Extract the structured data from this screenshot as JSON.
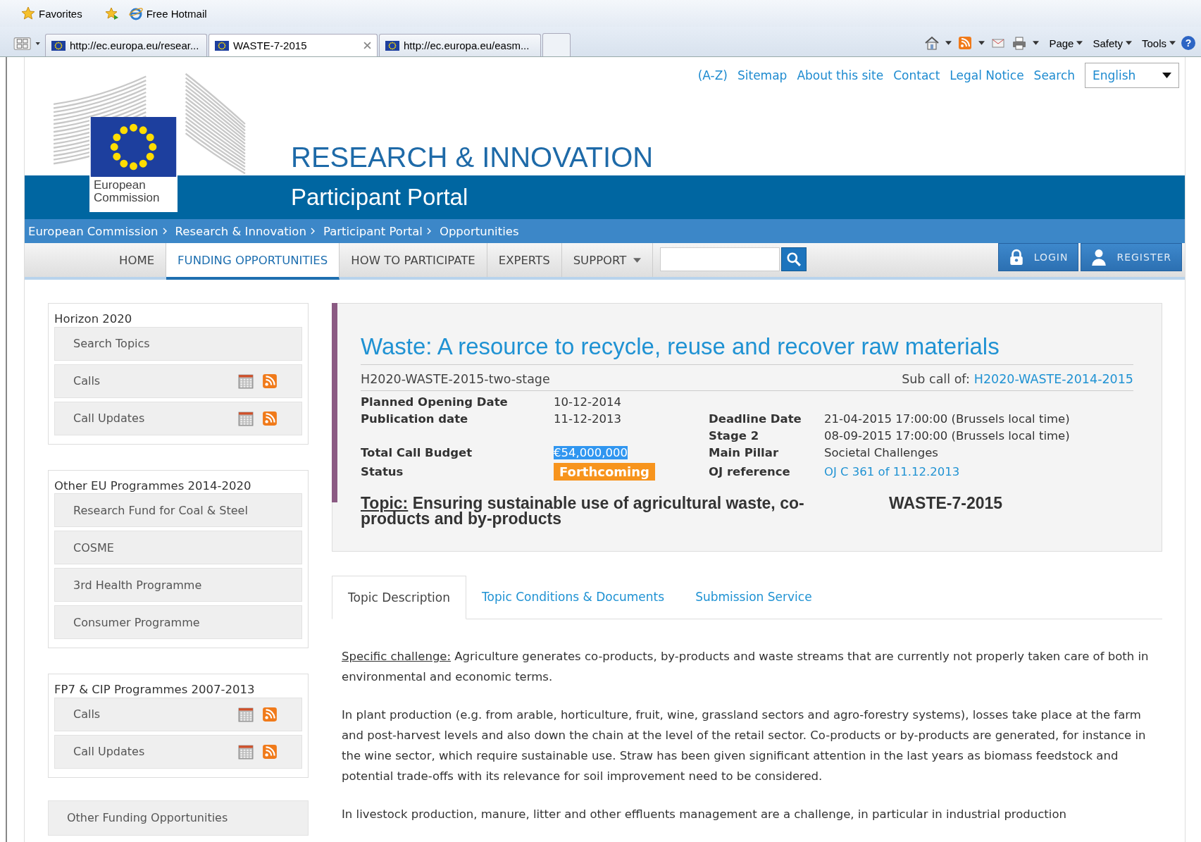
{
  "browser": {
    "favorites_bar": {
      "favorites_label": "Favorites",
      "links": [
        "Free Hotmail"
      ]
    },
    "tabs": [
      {
        "title": "http://ec.europa.eu/resear...",
        "selected": false
      },
      {
        "title": "WASTE-7-2015",
        "selected": true
      },
      {
        "title": "http://ec.europa.eu/easm...",
        "selected": false
      }
    ],
    "command_bar": [
      "Page",
      "Safety",
      "Tools"
    ],
    "help_label": "?"
  },
  "utility_links": [
    "(A-Z)",
    "Sitemap",
    "About this site",
    "Contact",
    "Legal Notice",
    "Search"
  ],
  "language": "English",
  "logo_text": "European Commission",
  "site_title": "RESEARCH & INNOVATION",
  "portal_title": "Participant Portal",
  "breadcrumb": [
    "European Commission",
    "Research & Innovation",
    "Participant Portal",
    "Opportunities"
  ],
  "nav": [
    {
      "label": "HOME",
      "selected": false,
      "dropdown": false
    },
    {
      "label": "FUNDING OPPORTUNITIES",
      "selected": true,
      "dropdown": false
    },
    {
      "label": "HOW TO PARTICIPATE",
      "selected": false,
      "dropdown": false
    },
    {
      "label": "EXPERTS",
      "selected": false,
      "dropdown": false
    },
    {
      "label": "SUPPORT",
      "selected": false,
      "dropdown": true
    }
  ],
  "account_buttons": [
    {
      "kind": "login",
      "label": "LOGIN"
    },
    {
      "kind": "register",
      "label": "REGISTER"
    }
  ],
  "sidebar": {
    "sections": [
      {
        "title": "Horizon 2020",
        "items": [
          {
            "label": "Search Topics",
            "kind": "plain"
          },
          {
            "label": "Calls",
            "kind": "feeds"
          },
          {
            "label": "Call Updates",
            "kind": "feeds"
          }
        ]
      },
      {
        "title": "Other EU Programmes 2014-2020",
        "items": [
          {
            "label": "Research Fund for Coal & Steel",
            "kind": "plain"
          },
          {
            "label": "COSME",
            "kind": "plain"
          },
          {
            "label": "3rd Health Programme",
            "kind": "plain"
          },
          {
            "label": "Consumer Programme",
            "kind": "plain"
          }
        ]
      },
      {
        "title": "FP7 & CIP Programmes 2007-2013",
        "items": [
          {
            "label": "Calls",
            "kind": "feeds"
          },
          {
            "label": "Call Updates",
            "kind": "feeds"
          }
        ]
      }
    ],
    "bottom_link": "Other Funding Opportunities"
  },
  "call": {
    "title": "Waste: A resource to recycle, reuse and recover raw materials",
    "identifier": "H2020-WASTE-2015-two-stage",
    "sub_call_label": "Sub call of:",
    "sub_call": "H2020-WASTE-2014-2015",
    "rows": [
      {
        "left": {
          "label": "Planned Opening Date",
          "value": "10-12-2014",
          "kind": "text"
        }
      },
      {
        "left": {
          "label": "Publication date",
          "value": "11-12-2013",
          "kind": "text"
        },
        "right": {
          "label": "Deadline Date",
          "value": "21-04-2015 17:00:00 (Brussels local time)",
          "kind": "text"
        }
      },
      {
        "right": {
          "label": "Stage 2",
          "value": "08-09-2015 17:00:00 (Brussels local time)",
          "kind": "text"
        }
      },
      {
        "left": {
          "label": "Total Call Budget",
          "value": "€54,000,000",
          "kind": "highlighted"
        },
        "right": {
          "label": "Main Pillar",
          "value": "Societal Challenges",
          "kind": "text"
        }
      },
      {
        "left": {
          "label": "Status",
          "value": "Forthcoming",
          "kind": "badge"
        },
        "right": {
          "label": "OJ reference",
          "value": "OJ C 361 of 11.12.2013",
          "kind": "link"
        }
      }
    ],
    "topic_label": "Topic:",
    "topic_title": "Ensuring sustainable use of agricultural waste, co-products and by-products",
    "topic_code": "WASTE-7-2015"
  },
  "content_tabs": [
    {
      "label": "Topic Description",
      "selected": true
    },
    {
      "label": "Topic Conditions & Documents",
      "selected": false
    },
    {
      "label": "Submission Service",
      "selected": false
    }
  ],
  "paragraphs": [
    {
      "label": "Specific challenge:",
      "text": "Agriculture generates co-products, by-products and waste streams that are currently not properly taken care of both in environmental and economic terms."
    },
    {
      "text": "In plant production (e.g. from arable, horticulture, fruit, wine, grassland sectors and agro-forestry systems), losses take place at the farm and post-harvest levels and also down the chain at the level of the retail sector. Co-products or by-products are generated, for instance in the wine sector, which require sustainable use. Straw has been given significant attention in the last years as biomass feedstock and potential trade-offs with its relevance for soil improvement need to be considered."
    },
    {
      "text": "In livestock production, manure, litter and other effluents management are a challenge, in particular in industrial production"
    }
  ]
}
